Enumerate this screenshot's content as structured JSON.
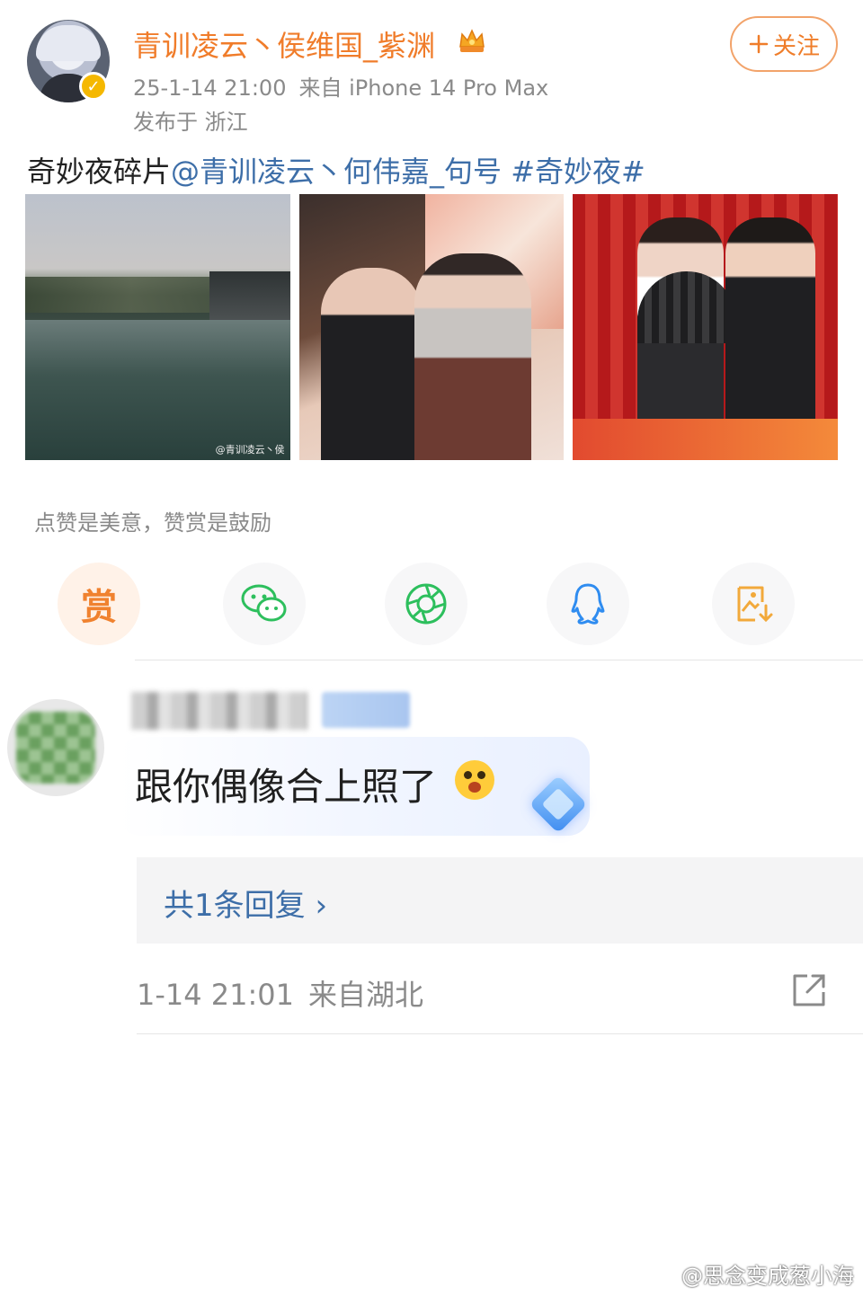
{
  "post": {
    "username": "青训凌云丶侯维国_紫渊",
    "timestamp": "25-1-14 21:00",
    "source": "来自 iPhone 14 Pro Max",
    "location": "发布于 浙江",
    "follow_label": "关注",
    "text_prefix": "奇妙夜碎片",
    "mention": "@青训凌云丶何伟嘉_句号",
    "hashtag": "#奇妙夜#",
    "photo_watermark": "@青训凌云丶侯"
  },
  "reward": {
    "hint": "点赞是美意，赞赏是鼓励",
    "reward_label": "赏"
  },
  "share_icons": [
    "reward-icon",
    "wechat-icon",
    "moments-icon",
    "qq-icon",
    "save-image-icon"
  ],
  "comment": {
    "text": "跟你偶像合上照了",
    "replies_label": "共1条回复",
    "time": "1-14 21:01",
    "source": "来自湖北"
  },
  "watermark": "@思念变成葱小海",
  "colors": {
    "accent_orange": "#f07c2a",
    "link_blue": "#3d6ea8",
    "meta_gray": "#8a8a8a"
  }
}
